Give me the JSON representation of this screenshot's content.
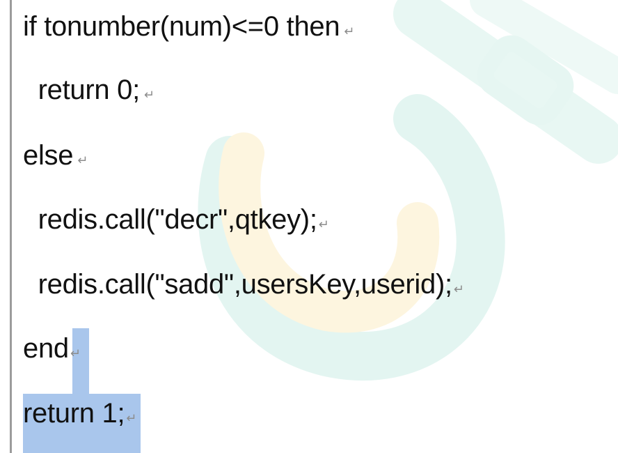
{
  "document": {
    "lines": [
      {
        "text": "if tonumber(num)<=0 then",
        "mark": "↵"
      },
      {
        "text": "  return 0;",
        "mark": "↵"
      },
      {
        "text": "else",
        "mark": "↵"
      },
      {
        "text": "  redis.call(\"decr\",qtkey);",
        "mark": "↵"
      },
      {
        "text": "  redis.call(\"sadd\",usersKey,userid);",
        "mark": "↵"
      },
      {
        "text": "end",
        "mark": "↵"
      },
      {
        "text": "return 1;",
        "mark": "↵"
      }
    ]
  },
  "colors": {
    "selection": "#a9c6ec",
    "watermark_teal": "#e3f5f1",
    "watermark_yellow": "#fdf5df"
  }
}
